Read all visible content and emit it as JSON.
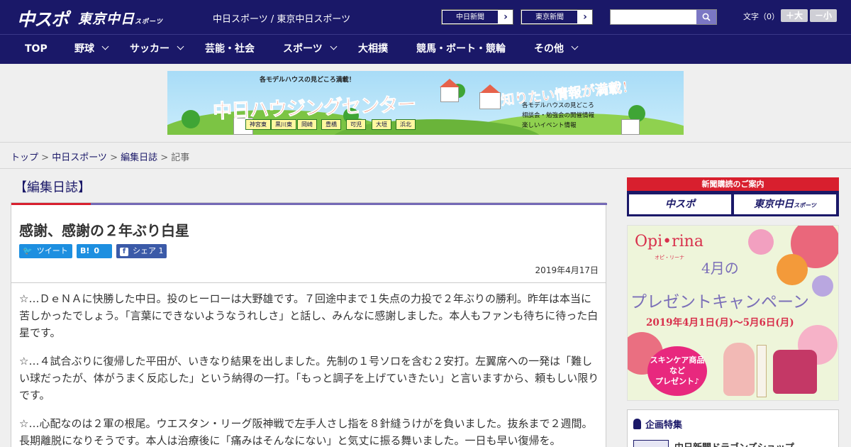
{
  "header": {
    "logo": "中スポ",
    "logo2": "東京中日",
    "logo2_suffix": "スポーツ",
    "site_name": "中日スポーツ / 東京中日スポーツ",
    "papers": [
      "中日新聞",
      "東京新聞"
    ],
    "font_size_label": "文字（0）",
    "font_bigger": "＋大",
    "font_smaller": "－小"
  },
  "nav": [
    {
      "label": "TOP",
      "has_menu": false
    },
    {
      "label": "野球",
      "has_menu": true
    },
    {
      "label": "サッカー",
      "has_menu": true
    },
    {
      "label": "芸能・社会",
      "has_menu": false
    },
    {
      "label": "スポーツ",
      "has_menu": true
    },
    {
      "label": "大相撲",
      "has_menu": false
    },
    {
      "label": "競馬・ボート・競輪",
      "has_menu": false
    },
    {
      "label": "その他",
      "has_menu": true
    }
  ],
  "banner": {
    "top": "各モデルハウスの見どころ満載！",
    "title": "中日ハウジングセンター",
    "catch": "知りたい情報が満載！",
    "lines": [
      "各モデルハウスの見どころ",
      "相談会・勉強会の開催情報",
      "楽しいイベント情報"
    ],
    "places": [
      "神宮東",
      "黒川東",
      "岡崎",
      "豊橋",
      "可児",
      "大垣",
      "浜北"
    ]
  },
  "breadcrumb": {
    "items": [
      "トップ",
      "中日スポーツ",
      "編集日誌"
    ],
    "current": "記事"
  },
  "section_title": "【編集日誌】",
  "article": {
    "title": "感謝、感謝の２年ぶり白星",
    "tweet": "ツイート",
    "hatena": "B!",
    "hatena_count": "0",
    "share": "シェア",
    "share_count": "1",
    "date": "2019年4月17日",
    "paragraphs": [
      "☆…ＤｅＮＡに快勝した中日。投のヒーローは大野雄です。７回途中まで１失点の力投で２年ぶりの勝利。昨年は本当に苦しかったでしょう。「言葉にできないようなうれしさ」と話し、みんなに感謝しました。本人もファンも待ちに待った白星です。",
      "☆…４試合ぶりに復帰した平田が、いきなり結果を出しました。先制の１号ソロを含む２安打。左翼席への一発は「難しい球だったが、体がうまく反応した」という納得の一打。「もっと調子を上げていきたい」と言いますから、頼もしい限りです。",
      "☆…心配なのは２軍の根尾。ウエスタン・リーグ阪神戦で左手人さし指を８針縫うけがを負いました。抜糸まで２週間。長期離脱になりそうです。本人は治療後に「痛みはそんなにない」と気丈に振る舞いました。一日も早い復帰を。"
    ]
  },
  "sidebar": {
    "subscribe_head": "新聞購読のご案内",
    "subscribe_left": "中スポ",
    "subscribe_right": "東京中日",
    "subscribe_right_suffix": "スポーツ",
    "promo": {
      "brand": "Opi•rina",
      "brand_sub": "オピ・リーナ",
      "month": "4月の",
      "campaign": "プレゼントキャンペーン",
      "period": "2019年4月1日(月)～5月6日(月)",
      "circle": [
        "スキンケア商品",
        "など",
        "プレゼント♪"
      ]
    },
    "feature_head": "企画特集",
    "feature_item": "中日新聞ドラゴンズショップ"
  },
  "colors": {
    "navy": "#1a1868",
    "accent_red": "#d81f2e",
    "accent_purple": "#7469b6",
    "twitter": "#1d8fe0",
    "hatena": "#1d8fe0",
    "facebook": "#3b5aa8"
  }
}
